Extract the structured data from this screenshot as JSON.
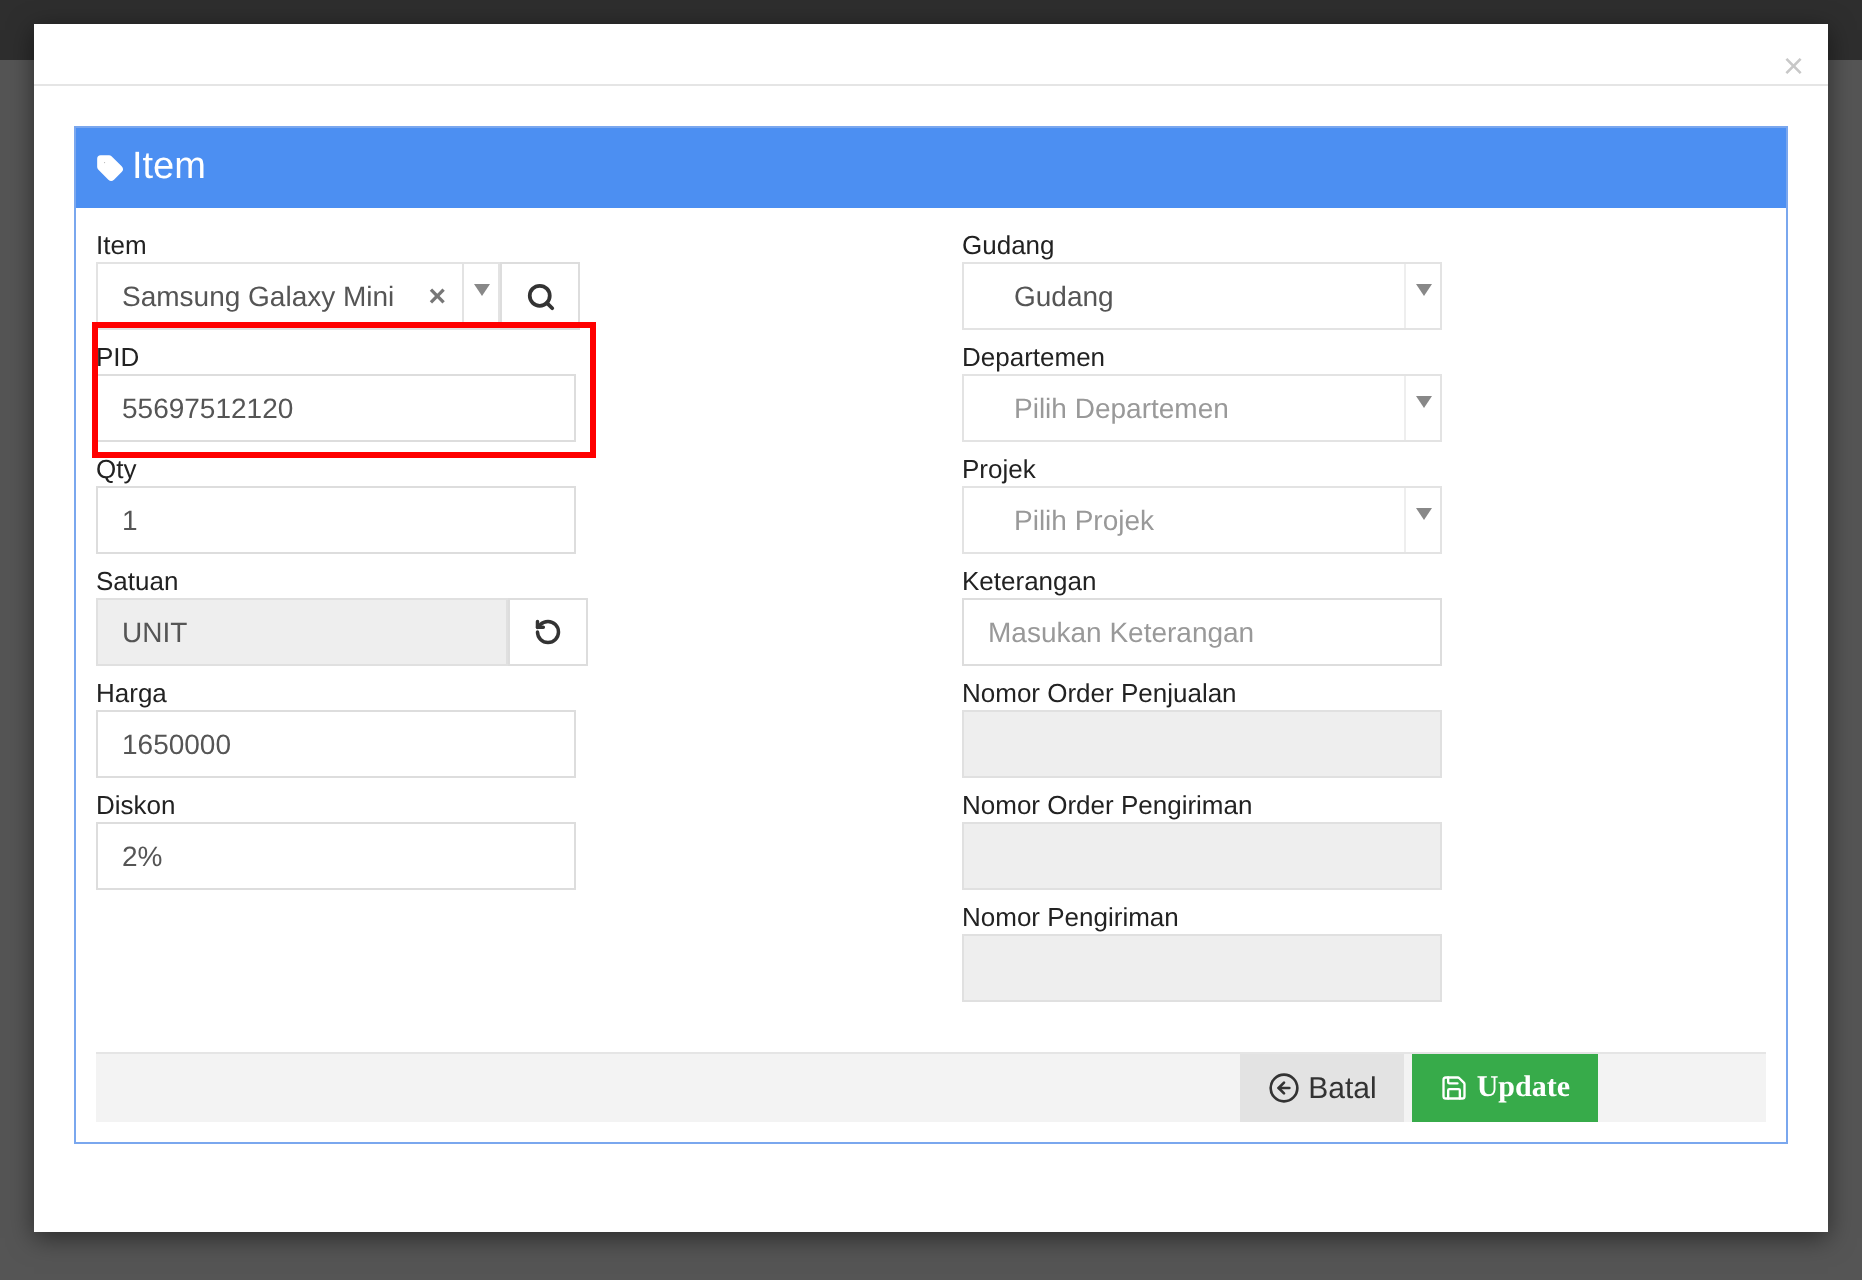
{
  "modal": {
    "close": "×",
    "panel_title": "Item",
    "left_fields": [
      {
        "kind": "select-search",
        "label": "Item",
        "value": "Samsung Galaxy Mini",
        "clear": "×",
        "highlighted": false
      },
      {
        "kind": "text",
        "label": "PID",
        "value": "55697512120",
        "highlighted": true
      },
      {
        "kind": "text",
        "label": "Qty",
        "value": "1",
        "highlighted": false
      },
      {
        "kind": "unit",
        "label": "Satuan",
        "value": "UNIT",
        "disabled": true,
        "highlighted": false
      },
      {
        "kind": "text",
        "label": "Harga",
        "value": "1650000",
        "highlighted": false
      },
      {
        "kind": "text",
        "label": "Diskon",
        "value": "2%",
        "highlighted": false
      }
    ],
    "right_fields": [
      {
        "kind": "select",
        "label": "Gudang",
        "value": "Gudang"
      },
      {
        "kind": "select",
        "label": "Departemen",
        "placeholder": "Pilih Departemen"
      },
      {
        "kind": "select",
        "label": "Projek",
        "placeholder": "Pilih Projek"
      },
      {
        "kind": "text",
        "label": "Keterangan",
        "placeholder": "Masukan Keterangan",
        "disabled": false
      },
      {
        "kind": "text",
        "label": "Nomor Order Penjualan",
        "disabled": true
      },
      {
        "kind": "text",
        "label": "Nomor Order Pengiriman",
        "disabled": true
      },
      {
        "kind": "text",
        "label": "Nomor Pengiriman",
        "disabled": true
      }
    ],
    "buttons": [
      {
        "kind": "cancel",
        "label": "Batal"
      },
      {
        "kind": "save",
        "label": "Update"
      }
    ]
  }
}
